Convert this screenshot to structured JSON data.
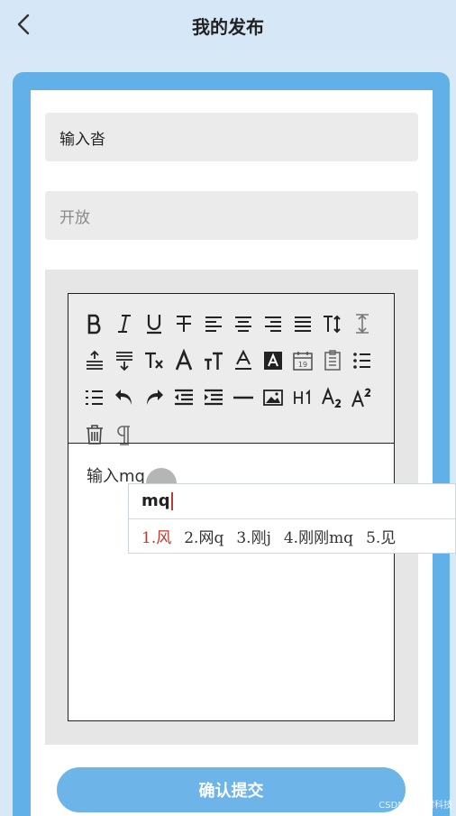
{
  "header": {
    "title": "我的发布",
    "back_icon": "chevron-left-icon"
  },
  "form": {
    "title_value": "输入沓",
    "status_value": "开放",
    "editor_content": "输入mq",
    "submit_label": "确认提交"
  },
  "toolbar": {
    "rows": [
      [
        "bold-icon",
        "italic-icon",
        "underline-icon",
        "strikethrough-icon",
        "align-left-icon",
        "align-center-icon",
        "align-right-icon",
        "align-justify-icon",
        "font-size-icon",
        "line-height-icon"
      ],
      [
        "paragraph-spacing-before-icon",
        "paragraph-spacing-after-icon",
        "clear-format-icon",
        "font-color-icon",
        "text-size-icon",
        "underline-color-icon",
        "highlight-icon",
        "date-icon",
        "checklist-icon",
        "unordered-list-icon"
      ],
      [
        "ordered-list-icon",
        "undo-icon",
        "redo-icon",
        "outdent-icon",
        "indent-icon",
        "horizontal-rule-icon",
        "image-icon",
        "heading-icon",
        "subscript-icon",
        "superscript-icon"
      ],
      [
        "delete-icon",
        "paragraph-mark-icon"
      ]
    ]
  },
  "ime": {
    "composition": "mq",
    "candidates": [
      "1.风",
      "2.网q",
      "3.刚j",
      "4.刚刚mq",
      "5.见"
    ]
  },
  "watermark": "CSDN @辉时科技",
  "colors": {
    "accent": "#62b0e8",
    "button": "#6db4e8",
    "ime_selected": "#c0392b",
    "header_bg": "#d6e7f7"
  }
}
